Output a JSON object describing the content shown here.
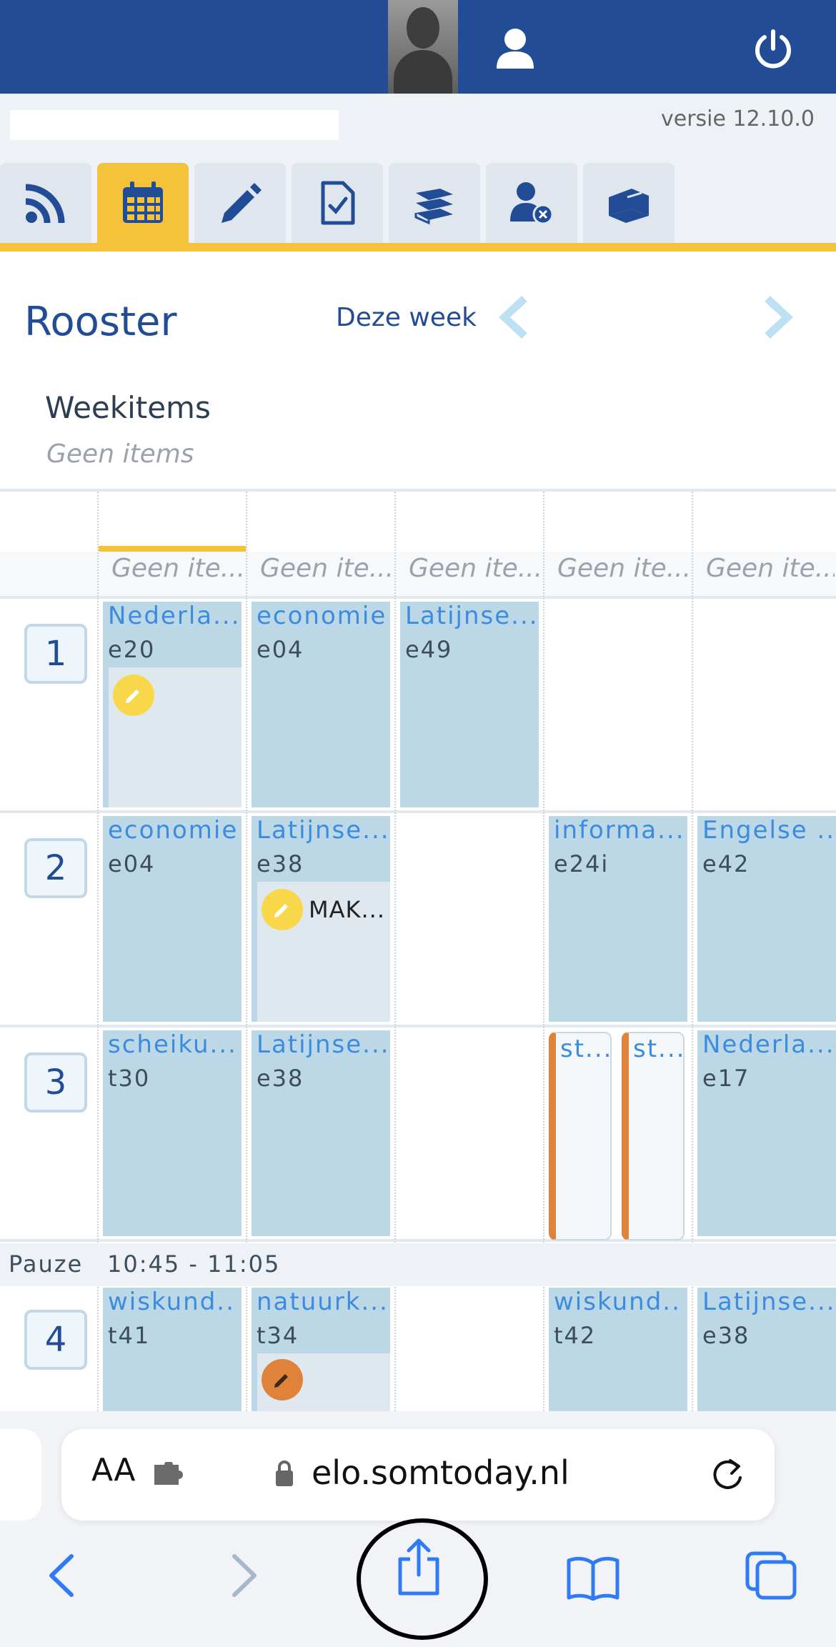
{
  "header": {
    "version": "versie 12.10.0",
    "user_icon": "user-icon",
    "power_icon": "power-icon"
  },
  "tabs": [
    {
      "icon": "rss-icon"
    },
    {
      "icon": "calendar-icon",
      "active": true
    },
    {
      "icon": "pencil-icon"
    },
    {
      "icon": "clipboard-check-icon"
    },
    {
      "icon": "books-icon"
    },
    {
      "icon": "user-absent-icon"
    },
    {
      "icon": "book-icon"
    }
  ],
  "page": {
    "title": "Rooster",
    "this_week": "Deze week",
    "weekitems_title": "Weekitems",
    "weekitems_empty": "Geen items"
  },
  "day_items": [
    "Geen ite...",
    "Geen ite...",
    "Geen ite...",
    "Geen ite...",
    "Geen ite..."
  ],
  "hours": [
    "1",
    "2",
    "3",
    "4"
  ],
  "lessons": {
    "h1": [
      {
        "subject": "Nederla...",
        "room": "e20"
      },
      {
        "subject": "economie",
        "room": "e04"
      },
      {
        "subject": "Latijnse...",
        "room": "e49"
      }
    ],
    "h2": [
      {
        "subject": "economie",
        "room": "e04"
      },
      {
        "subject": "Latijnse...",
        "room": "e38",
        "note": "MAK..."
      },
      {
        "subject": "informa...",
        "room": "e24i"
      },
      {
        "subject": "Engelse ...",
        "room": "e42"
      }
    ],
    "h3": [
      {
        "subject": "scheiku...",
        "room": "t30"
      },
      {
        "subject": "Latijnse...",
        "room": "e38"
      },
      {
        "subject": "st...",
        "cancelled": true
      },
      {
        "subject": "st...",
        "cancelled": true
      },
      {
        "subject": "Nederla...",
        "room": "e17"
      }
    ],
    "h4": [
      {
        "subject": "wiskund...",
        "room": "t41"
      },
      {
        "subject": "natuurk...",
        "room": "t34"
      },
      {
        "subject": "wiskund...",
        "room": "t42"
      },
      {
        "subject": "Latijnse...",
        "room": "e38"
      }
    ]
  },
  "pauze": {
    "label": "Pauze",
    "time": "10:45 - 11:05"
  },
  "browser": {
    "text_size": "AA",
    "url": "elo.somtoday.nl"
  },
  "colors": {
    "brand_blue": "#224c96",
    "accent_yellow": "#f5c33b",
    "lesson_bg": "#bcd8e6",
    "cancel_orange": "#e0833a"
  }
}
